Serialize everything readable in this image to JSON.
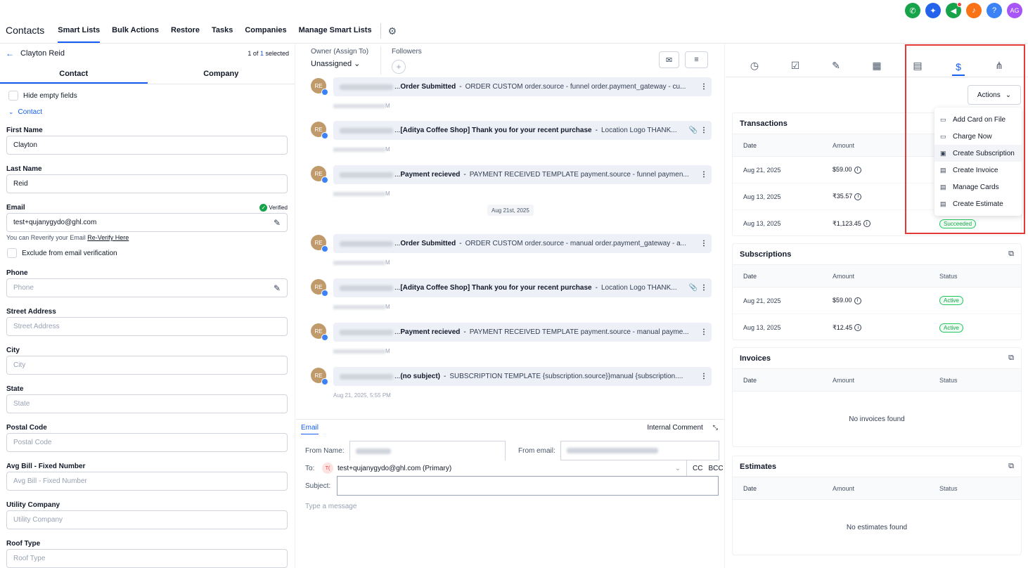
{
  "top_icons": [
    {
      "name": "phone-icon",
      "color": "#16a34a",
      "glyph": "✆"
    },
    {
      "name": "sparkle-icon",
      "color": "#2563eb",
      "glyph": "✦"
    },
    {
      "name": "megaphone-icon",
      "color": "#16a34a",
      "glyph": "📢"
    },
    {
      "name": "bell-icon",
      "color": "#f97316",
      "glyph": "🔔"
    },
    {
      "name": "help-icon",
      "color": "#3b82f6",
      "glyph": "?"
    },
    {
      "name": "avatar",
      "color": "#a855f7",
      "glyph": "AG"
    }
  ],
  "nav": {
    "title": "Contacts",
    "tabs": [
      "Smart Lists",
      "Bulk Actions",
      "Restore",
      "Tasks",
      "Companies",
      "Manage Smart Lists"
    ]
  },
  "left": {
    "contact_name": "Clayton Reid",
    "position": {
      "a": "1 of",
      "b": "1",
      "c": "selected"
    },
    "tabs": [
      "Contact",
      "Company"
    ],
    "hide_empty": "Hide empty fields",
    "section": "Contact",
    "first_name": {
      "label": "First Name",
      "value": "Clayton"
    },
    "last_name": {
      "label": "Last Name",
      "value": "Reid"
    },
    "email": {
      "label": "Email",
      "verified": "Verified",
      "value": "test+qujanygydo@ghl.com"
    },
    "reverify_text": "You can Reverify your Email",
    "reverify_link": "Re-Verify Here",
    "exclude": "Exclude from email verification",
    "phone": {
      "label": "Phone",
      "placeholder": "Phone"
    },
    "street": {
      "label": "Street Address",
      "placeholder": "Street Address"
    },
    "city": {
      "label": "City",
      "placeholder": "City"
    },
    "state": {
      "label": "State",
      "placeholder": "State"
    },
    "postal": {
      "label": "Postal Code",
      "placeholder": "Postal Code"
    },
    "avg_bill": {
      "label": "Avg Bill - Fixed Number",
      "placeholder": "Avg Bill - Fixed Number"
    },
    "utility": {
      "label": "Utility Company",
      "placeholder": "Utility Company"
    },
    "roof": {
      "label": "Roof Type",
      "placeholder": "Roof Type"
    }
  },
  "middle": {
    "owner_label": "Owner (Assign To)",
    "owner_value": "Unassigned",
    "followers_label": "Followers",
    "messages": [
      {
        "subject": "Order Submitted",
        "body": "ORDER CUSTOM order.source - funnel order.payment_gateway - cu...",
        "ts": "M",
        "clip": false
      },
      {
        "subject": "[Aditya Coffee Shop] Thank you for your recent purchase",
        "body": "Location Logo THANK...",
        "ts": "M",
        "clip": true
      },
      {
        "subject": "Payment recieved",
        "body": "PAYMENT RECEIVED TEMPLATE payment.source - funnel paymen...",
        "ts": "M",
        "clip": false
      },
      {
        "subject": "Order Submitted",
        "body": "ORDER CUSTOM order.source - manual order.payment_gateway - a...",
        "ts": "M",
        "clip": false
      },
      {
        "subject": "[Aditya Coffee Shop] Thank you for your recent purchase",
        "body": "Location Logo THANK...",
        "ts": "M",
        "clip": true
      },
      {
        "subject": "Payment recieved",
        "body": "PAYMENT RECEIVED TEMPLATE payment.source - manual payme...",
        "ts": "M",
        "clip": false
      },
      {
        "subject": "(no subject)",
        "body": "SUBSCRIPTION TEMPLATE {subscription.source}}manual {subscription....",
        "ts": "Aug 21, 2025, 5:55 PM",
        "clip": false
      }
    ],
    "date_divider": "Aug 21st, 2025",
    "composer": {
      "tab_email": "Email",
      "tab_comment": "Internal Comment",
      "from_name_label": "From Name:",
      "from_email_label": "From email:",
      "to_label": "To:",
      "to_initials": "T(",
      "to_value": "test+qujanygydo@ghl.com (Primary)",
      "cc": "CC",
      "bcc": "BCC",
      "subject_label": "Subject:",
      "message_placeholder": "Type a message"
    }
  },
  "right": {
    "actions_label": "Actions",
    "menu": [
      "Add Card on File",
      "Charge Now",
      "Create Subscription",
      "Create Invoice",
      "Manage Cards",
      "Create Estimate"
    ],
    "transactions": {
      "title": "Transactions",
      "headers": [
        "Date",
        "Amount"
      ],
      "rows": [
        {
          "date": "Aug 21, 2025",
          "amount": "$59.00",
          "status": ""
        },
        {
          "date": "Aug 13, 2025",
          "amount": "₹35.57",
          "status": ""
        },
        {
          "date": "Aug 13, 2025",
          "amount": "₹1,123.45",
          "status": "Succeeded"
        }
      ]
    },
    "subscriptions": {
      "title": "Subscriptions",
      "headers": [
        "Date",
        "Amount",
        "Status"
      ],
      "rows": [
        {
          "date": "Aug 21, 2025",
          "amount": "$59.00",
          "status": "Active"
        },
        {
          "date": "Aug 13, 2025",
          "amount": "₹12.45",
          "status": "Active"
        }
      ]
    },
    "invoices": {
      "title": "Invoices",
      "headers": [
        "Date",
        "Amount",
        "Status"
      ],
      "empty": "No invoices found"
    },
    "estimates": {
      "title": "Estimates",
      "headers": [
        "Date",
        "Amount",
        "Status"
      ],
      "empty": "No estimates found"
    }
  }
}
